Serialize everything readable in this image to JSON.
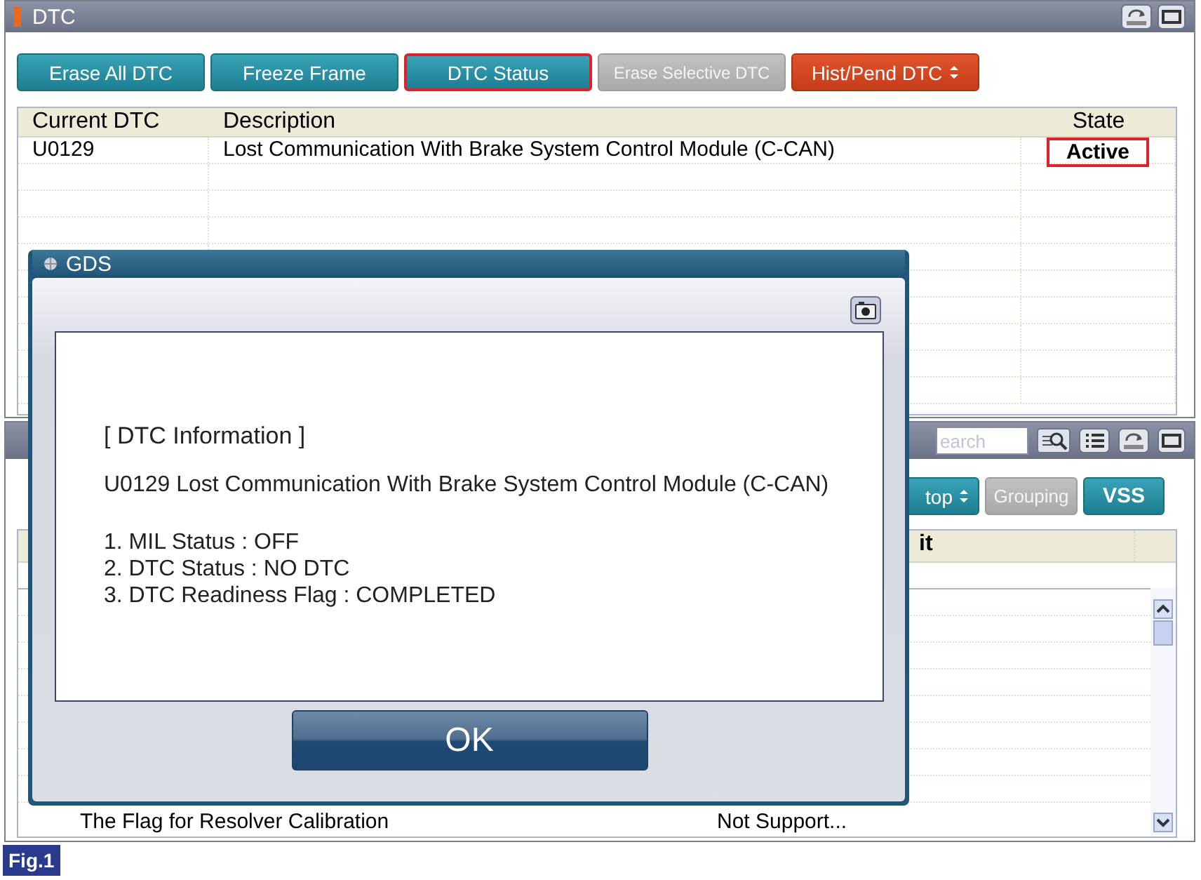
{
  "dtc_window": {
    "title": "DTC",
    "buttons": [
      {
        "label": "Erase All DTC",
        "kind": "normal",
        "selected": false,
        "disabled": false
      },
      {
        "label": "Freeze Frame",
        "kind": "normal",
        "selected": false,
        "disabled": false
      },
      {
        "label": "DTC Status",
        "kind": "normal",
        "selected": true,
        "disabled": false
      },
      {
        "label": "Erase Selective DTC",
        "kind": "normal",
        "selected": false,
        "disabled": true
      },
      {
        "label": "Hist/Pend DTC",
        "kind": "dropdown",
        "selected": false,
        "disabled": false
      }
    ],
    "table": {
      "columns": [
        "Current DTC",
        "Description",
        "State"
      ],
      "rows": [
        {
          "code": "U0129",
          "description": "Lost Communication With Brake System Control Module (C-CAN)",
          "state": "Active",
          "state_marked": true
        }
      ]
    }
  },
  "data_window": {
    "search": {
      "placeholder": "earch"
    },
    "buttons": [
      {
        "label": "top",
        "kind": "dropdown",
        "disabled": false
      },
      {
        "label": "Grouping",
        "kind": "normal",
        "disabled": true
      },
      {
        "label": "VSS",
        "kind": "normal",
        "disabled": false
      }
    ],
    "table": {
      "columns": [
        "it"
      ],
      "rows": [
        {
          "name": "The Flag for Resolver Calibration",
          "value": "Not Support..."
        }
      ]
    }
  },
  "dialog": {
    "title": "GDS",
    "heading": "[ DTC Information ]",
    "message": "U0129 Lost Communication With Brake System Control Module (C-CAN)",
    "items": [
      "1. MIL Status : OFF",
      "2. DTC Status : NO DTC",
      "3. DTC Readiness Flag : COMPLETED"
    ],
    "button": "OK"
  },
  "figure_label": "Fig.1"
}
